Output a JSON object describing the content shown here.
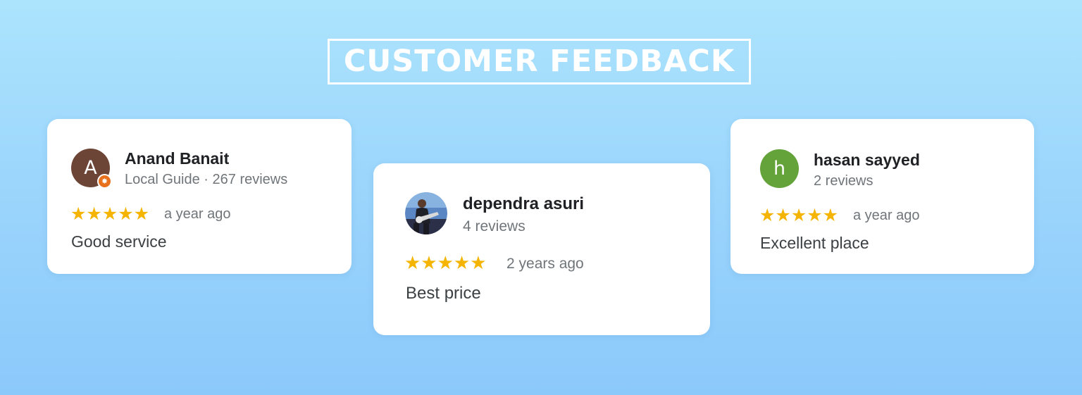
{
  "page": {
    "title": "CUSTOMER FEEDBACK"
  },
  "reviews": [
    {
      "avatar_letter": "A",
      "avatar_color": "#6d4536",
      "badge_icon": "local-guide-star-icon",
      "name": "Anand Banait",
      "meta": "Local Guide · 267 reviews",
      "rating": 5,
      "stars": "★★★★★",
      "time": "a year ago",
      "text": "Good service"
    },
    {
      "avatar_icon": "guitarist-photo-icon",
      "name": "dependra asuri",
      "meta": "4 reviews",
      "rating": 5,
      "stars": "★★★★★",
      "time": "2 years ago",
      "text": "Best price"
    },
    {
      "avatar_letter": "h",
      "avatar_color": "#64a23a",
      "name": "hasan sayyed",
      "meta": "2 reviews",
      "rating": 5,
      "stars": "★★★★★",
      "time": "a year ago",
      "text": "Excellent place"
    }
  ],
  "colors": {
    "star": "#f5b400",
    "badge": "#e8711e",
    "background_top": "#ace4fd",
    "background_bottom": "#8cc9fb"
  }
}
